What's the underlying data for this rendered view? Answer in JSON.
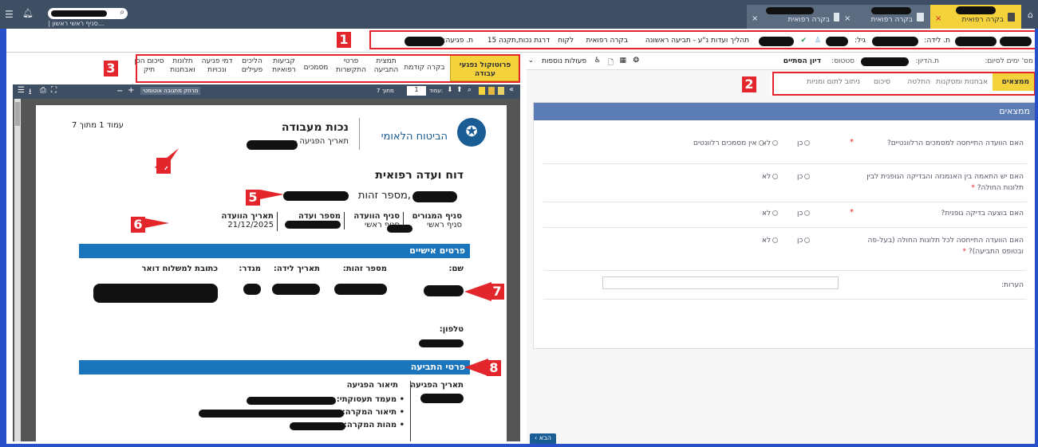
{
  "top_tabs": [
    {
      "label": "בקרה רפואית",
      "active": true
    },
    {
      "label": "בקרה רפואית",
      "active": false
    },
    {
      "label": "בקרה רפואית",
      "active": false
    }
  ],
  "search": {
    "branch_label": "| סניף ראשי ראשון..."
  },
  "info_bar": {
    "birth_date_label": "ת. לידה:",
    "age_label": "גיל:",
    "process_label": "תהליך ועדות נ\"ע - תביעה ראשונה",
    "control_label": "בקרה רפואית",
    "client_label": "לקוח",
    "grade_label": "דרגת נכות,תקנה 15",
    "injury_label": "ת. פגיעה:"
  },
  "doc_tabs": [
    {
      "label": "פרוטוקול נפגעי עבודה",
      "active": true
    },
    {
      "label": "בקרה קודמת"
    },
    {
      "label": "תמצית התביעה"
    },
    {
      "label": "פרטי התקשרות"
    },
    {
      "label": "מסמכים"
    },
    {
      "label": "קביעות רפואיות"
    },
    {
      "label": "הליכים פעילים"
    },
    {
      "label": "דמי פגיעה ונכויות"
    },
    {
      "label": "תלונות ואבחנות"
    },
    {
      "label": "סיכום הכן תיק"
    }
  ],
  "viewer": {
    "page_label": "עמוד:",
    "page_value": "1",
    "of_label": "מתוך 7",
    "zoom_option": "מרחק מתגובה אוטומטי"
  },
  "document": {
    "page_counter": "עמוד 1 מתוך 7",
    "org_name": "הביטוח הלאומי",
    "doc_title": "נכות מעבודה",
    "injury_date_label": "תאריך הפגיעה -",
    "report_title": "דוח ועדה רפואית",
    "id_label": ",מספר זהות",
    "table_headers": [
      "סניף המגורים",
      "סניף הוועדה",
      "מספר ועדה",
      "תאריך הוועדה"
    ],
    "table_values": [
      "סניף ראשי",
      "סניף ראשי",
      "",
      "21/12/2025"
    ],
    "personal_section": "פרטים אישיים",
    "personal_labels": [
      "שם:",
      "מספר זהות:",
      "תאריך לידה:",
      "מגדר:",
      "כתובת למשלוח דואר"
    ],
    "phone_label": "טלפון:",
    "claim_section": "פרטי התביעה",
    "claim_col1": "תאריך הפגיעה",
    "claim_col2": "תיאור הפגיעה",
    "claim_items": [
      "מעמד תעסוקתי:",
      "תיאור המקרה:",
      "מהות המקרה:"
    ]
  },
  "right": {
    "days_label": "מס' ימים לסיום:",
    "hearing_label": "ת.הדיון:",
    "status_label": "סטטוס:",
    "status_value": "דיון הסתיים",
    "more_actions": "פעולות נוספות",
    "steps": [
      "ממצאים",
      "אבחנות ומסקנות",
      "החלטה",
      "סיכום",
      "ניתוב לתום ומניות"
    ],
    "panel_title": "ממצאים",
    "questions": [
      {
        "text": "האם הוועדה התייחסה למסמכים הרלוונטיים?",
        "yes": "כן",
        "no": "לא",
        "extra": "אין מסמכים רלוונטים"
      },
      {
        "text": "האם יש התאמה בין האנמנזה והבדיקה הגופנית לבין תלונות החולה?",
        "yes": "כן",
        "no": "לא"
      },
      {
        "text": "האם בוצעה בדיקה גופנית?",
        "yes": "כן",
        "no": "לא"
      },
      {
        "text": "האם הוועדה התייחסה לכל תלונות החולה (בעל-פה ובטופס התביעה)?",
        "yes": "כן",
        "no": "לא"
      }
    ],
    "notes_label": "הערות:",
    "next_button": "הבא"
  },
  "annotations": [
    "1",
    "2",
    "3",
    "4",
    "5",
    "6",
    "7",
    "8"
  ],
  "colors": {
    "accent": "#f3d23c",
    "header": "#3f4f63",
    "section": "#1a75bb",
    "annotation": "#e3262b"
  }
}
